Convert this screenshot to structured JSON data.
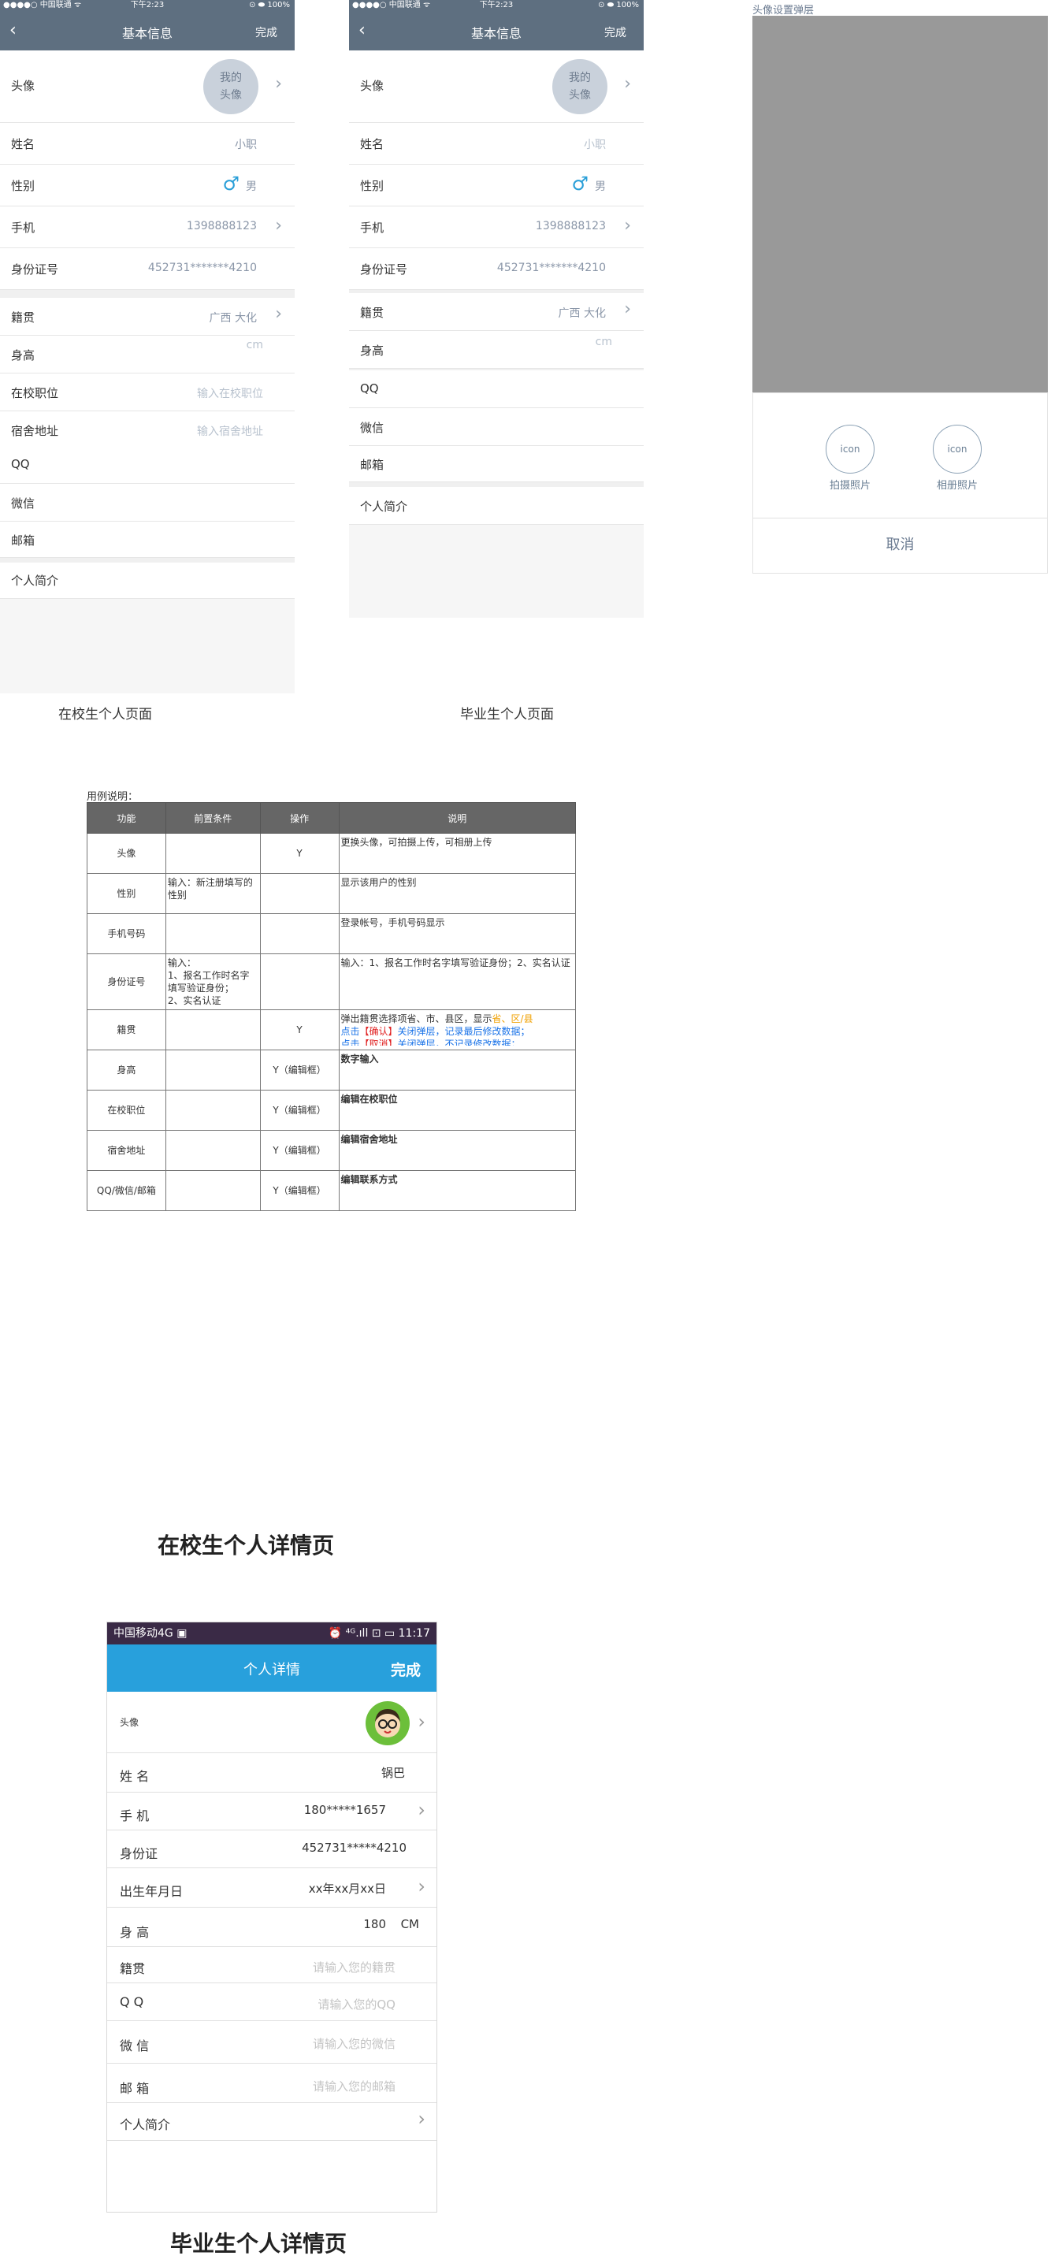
{
  "phone": {
    "status_left": "●●●●○ 中国联通 ᯤ",
    "status_time": "下午2:23",
    "status_right": "⊙ ⬬ 100%",
    "title": "基本信息",
    "done": "完成",
    "back_icon": "chevron-left-icon"
  },
  "student": {
    "avatar_label": "头像",
    "avatar_text_1": "我的",
    "avatar_text_2": "头像",
    "name_label": "姓名",
    "name_value": "小职",
    "gender_label": "性别",
    "gender_icon": "♂",
    "gender_value": "男",
    "phone_label": "手机",
    "phone_value": "1398888123",
    "id_label": "身份证号",
    "id_value": "452731*******4210",
    "native_label": "籍贯",
    "native_value": "广西  大化",
    "height_label": "身高",
    "height_value": "cm",
    "position_label": "在校职位",
    "position_placeholder": "输入在校职位",
    "dorm_label": "宿舍地址",
    "dorm_placeholder": "输入宿舍地址",
    "qq_label": "QQ",
    "wechat_label": "微信",
    "email_label": "邮箱",
    "bio_label": "个人简介",
    "caption": "在校生个人页面"
  },
  "graduate": {
    "avatar_label": "头像",
    "avatar_text_1": "我的",
    "avatar_text_2": "头像",
    "name_label": "姓名",
    "name_value": "小职",
    "gender_label": "性别",
    "gender_icon": "♂",
    "gender_value": "男",
    "phone_label": "手机",
    "phone_value": "1398888123",
    "id_label": "身份证号",
    "id_value": "452731*******4210",
    "native_label": "籍贯",
    "native_value": "广西  大化",
    "height_label": "身高",
    "height_value": "cm",
    "qq_label": "QQ",
    "wechat_label": "微信",
    "email_label": "邮箱",
    "bio_label": "个人简介",
    "caption": "毕业生个人页面"
  },
  "popup": {
    "title": "头像设置弹层",
    "camera_icon": "icon",
    "camera_label": "拍摄照片",
    "album_icon": "icon",
    "album_label": "相册照片",
    "cancel": "取消"
  },
  "spec": {
    "caption": "用例说明：",
    "headers": [
      "功能",
      "前置条件",
      "操作",
      "说明"
    ],
    "rows": [
      {
        "f": "头像",
        "p": "",
        "o": "Y",
        "d": "更换头像，可拍摄上传，可相册上传"
      },
      {
        "f": "性别",
        "p": "输入：新注册填写的性别",
        "o": "",
        "d": "显示该用户的性别"
      },
      {
        "f": "手机号码",
        "p": "",
        "o": "",
        "d": "登录帐号，手机号码显示"
      },
      {
        "f": "身份证号",
        "p": "输入：\n1、报名工作时名字填写验证身份；\n2、实名认证",
        "o": "",
        "d": "输入：1、报名工作时名字填写验证身份；2、实名认证"
      },
      {
        "f": "籍贯",
        "p": "",
        "o": "Y",
        "d1": "弹出籍贯选择项省、市、县区，显示",
        "d1b": "省、区/县",
        "d2a": "点击",
        "d2b": "【确认】",
        "d2c": "关闭弹层，记录最后修改数据；",
        "d3a": "点击",
        "d3b": "【取消】",
        "d3c": "关闭弹层，不记录修改数据；"
      },
      {
        "f": "身高",
        "p": "",
        "o": "Y（编辑框）",
        "d": "数字输入"
      },
      {
        "f": "在校职位",
        "p": "",
        "o": "Y（编辑框）",
        "d": "编辑在校职位"
      },
      {
        "f": "宿舍地址",
        "p": "",
        "o": "Y（编辑框）",
        "d": "编辑宿舍地址"
      },
      {
        "f": "QQ/微信/邮箱",
        "p": "",
        "o": "Y（编辑框）",
        "d": "编辑联系方式"
      }
    ]
  },
  "heading_student_detail": "在校生个人详情页",
  "detail": {
    "status_left": "中国移动4G ▣",
    "status_right": "⏰ ⁴ᴳ.ıll ⊡ ▭ 11:17",
    "title": "个人详情",
    "done": "完成",
    "avatar_label": "头像",
    "name_label": "姓 名",
    "name_value": "锅巴",
    "phone_label": "手 机",
    "phone_value": "180*****1657",
    "id_label": "身份证",
    "id_value": "452731*****4210",
    "birth_label": "出生年月日",
    "birth_value": "xx年xx月xx日",
    "height_label": "身 高",
    "height_value": "180",
    "height_unit": "CM",
    "native_label": "籍贯",
    "native_placeholder": "请输入您的籍贯",
    "qq_label": "Q  Q",
    "qq_placeholder": "请输入您的QQ",
    "wechat_label": "微 信",
    "wechat_placeholder": "请输入您的微信",
    "email_label": "邮 箱",
    "email_placeholder": "请输入您的邮箱",
    "bio_label": "个人简介"
  },
  "heading_graduate_detail": "毕业生个人详情页",
  "colors": {
    "nav_top": "#5e6f80",
    "nav_detail": "#28a0dc",
    "highlight_orange": "#f0a000",
    "link_blue": "#1a73e8",
    "red": "#e02020"
  }
}
